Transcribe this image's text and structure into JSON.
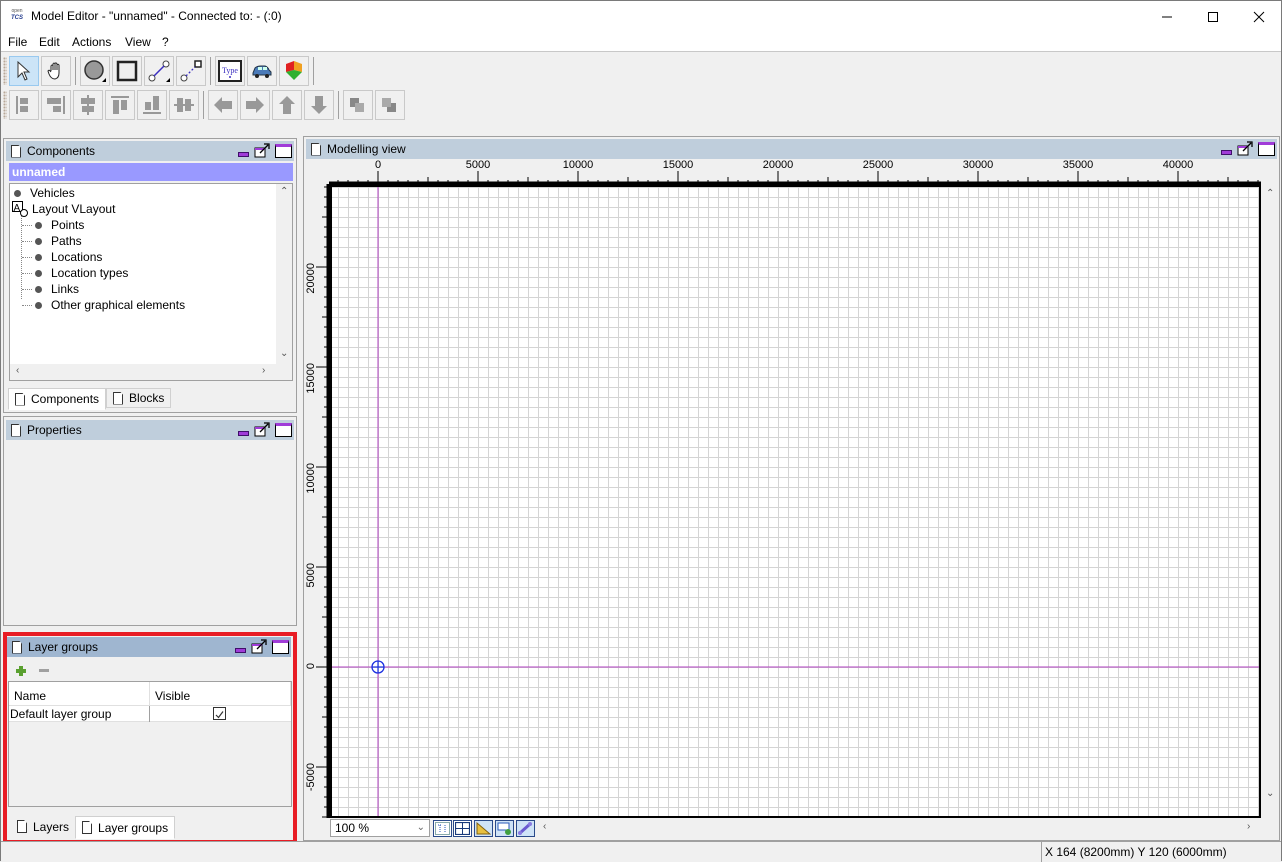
{
  "window": {
    "title": "Model Editor - \"unnamed\" - Connected to: - (:0)",
    "logo_top": "open",
    "logo_bottom": "TCS"
  },
  "menu": [
    "File",
    "Edit",
    "Actions",
    "View",
    "?"
  ],
  "toolbar_top": [
    {
      "name": "select-tool",
      "icon": "arrow-cursor-icon",
      "active": true
    },
    {
      "name": "drag-tool",
      "icon": "hand-icon",
      "active": false
    },
    {
      "name": "create-point",
      "icon": "circle-icon"
    },
    {
      "name": "create-location",
      "icon": "square-icon"
    },
    {
      "name": "create-path",
      "icon": "path-icon"
    },
    {
      "name": "create-link",
      "icon": "link-icon"
    },
    {
      "name": "create-location-type",
      "icon": "type-icon"
    },
    {
      "name": "create-vehicle",
      "icon": "vehicle-icon"
    },
    {
      "name": "create-block",
      "icon": "block-icon"
    }
  ],
  "toolbar_bottom": [
    "align-left",
    "align-right",
    "align-center-h",
    "align-top",
    "align-bottom",
    "align-center-v",
    "move-left",
    "move-right",
    "move-up",
    "move-down",
    "bring-forward",
    "send-backward"
  ],
  "components_panel": {
    "title": "Components",
    "model_name": "unnamed",
    "tree": {
      "vehicles": "Vehicles",
      "layout": "Layout VLayout",
      "children": [
        "Points",
        "Paths",
        "Locations",
        "Location types",
        "Links",
        "Other graphical elements"
      ]
    },
    "tabs": [
      "Components",
      "Blocks"
    ],
    "selected_tab": "Components"
  },
  "properties_panel": {
    "title": "Properties"
  },
  "layer_groups_panel": {
    "title": "Layer groups",
    "columns": [
      "Name",
      "Visible"
    ],
    "rows": [
      {
        "name": "Default layer group",
        "visible": true
      }
    ],
    "tabs": [
      "Layers",
      "Layer groups"
    ],
    "selected_tab": "Layer groups"
  },
  "modelling_view": {
    "title": "Modelling view",
    "x_ticks": [
      "0",
      "5000",
      "10000",
      "15000",
      "20000",
      "25000",
      "30000",
      "35000",
      "40000"
    ],
    "y_ticks": [
      "20000",
      "15000",
      "10000",
      "5000",
      "0",
      "-5000"
    ],
    "zoom_level": "100 %",
    "view_buttons": [
      "toggle-labels",
      "toggle-grid",
      "toggle-ruler",
      "toggle-blocks",
      "toggle-links"
    ]
  },
  "status": {
    "coordinates": "X 164 (8200mm) Y 120 (6000mm)"
  },
  "colors": {
    "panel_header": "#bfcedc",
    "model_name_bg": "#9999ff",
    "highlight_frame": "#e81c24",
    "axis_line": "#b040c0",
    "origin_marker": "#1a2ee0"
  }
}
